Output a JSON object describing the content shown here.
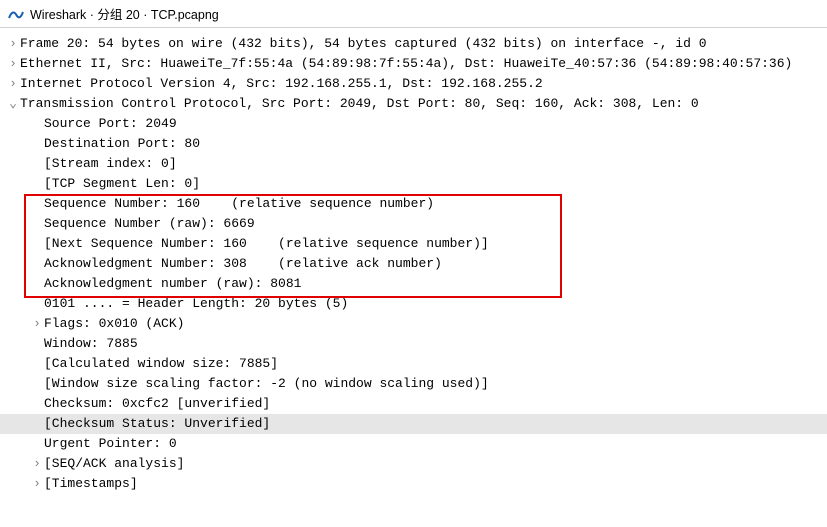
{
  "title": "Wireshark · 分组 20 · TCP.pcapng",
  "tree": {
    "frame": "Frame 20: 54 bytes on wire (432 bits), 54 bytes captured (432 bits) on interface -, id 0",
    "ethernet": "Ethernet II, Src: HuaweiTe_7f:55:4a (54:89:98:7f:55:4a), Dst: HuaweiTe_40:57:36 (54:89:98:40:57:36)",
    "ip": "Internet Protocol Version 4, Src: 192.168.255.1, Dst: 192.168.255.2",
    "tcp_header": "Transmission Control Protocol, Src Port: 2049, Dst Port: 80, Seq: 160, Ack: 308, Len: 0",
    "tcp": {
      "src_port": "Source Port: 2049",
      "dst_port": "Destination Port: 80",
      "stream_index": "[Stream index: 0]",
      "seg_len": "[TCP Segment Len: 0]",
      "seq_num": "Sequence Number: 160    (relative sequence number)",
      "seq_raw": "Sequence Number (raw): 6669",
      "next_seq": "[Next Sequence Number: 160    (relative sequence number)]",
      "ack_num": "Acknowledgment Number: 308    (relative ack number)",
      "ack_raw": "Acknowledgment number (raw): 8081",
      "hdr_len": "0101 .... = Header Length: 20 bytes (5)",
      "flags": "Flags: 0x010 (ACK)",
      "window": "Window: 7885",
      "calc_win": "[Calculated window size: 7885]",
      "win_scale": "[Window size scaling factor: -2 (no window scaling used)]",
      "checksum": "Checksum: 0xcfc2 [unverified]",
      "checksum_status": "[Checksum Status: Unverified]",
      "urgent": "Urgent Pointer: 0",
      "seq_ack": "[SEQ/ACK analysis]",
      "timestamps": "[Timestamps]"
    }
  },
  "glyph": {
    "right": "›",
    "down": "⌄"
  }
}
